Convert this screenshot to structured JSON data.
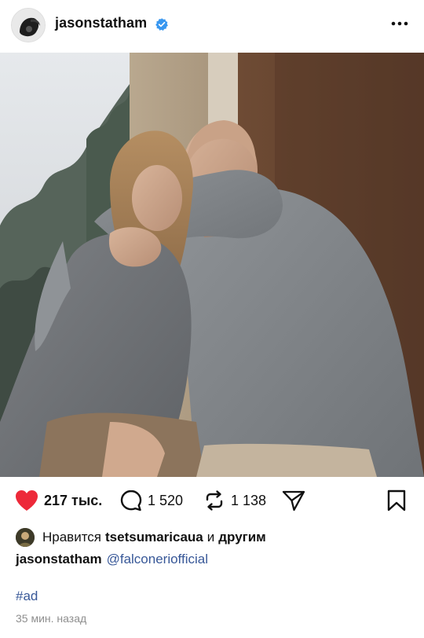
{
  "post": {
    "username": "jasonstatham",
    "likes_count": "217 тыс.",
    "comments_count": "1 520",
    "reposts_count": "1 138",
    "liked_by_prefix": "Нравится",
    "liked_by_user": "tsetsumaricauа",
    "liked_by_suffix": "и",
    "liked_by_others": "другим",
    "caption_user": "jasonstatham",
    "caption_mention": "@falconeriofficial",
    "hashtag": "#ad",
    "time_ago": "35 мин. назад"
  },
  "colors": {
    "like_red": "#ed2939",
    "link_blue": "#385898",
    "verified_blue": "#3897f0",
    "muted": "#8e8e8e"
  },
  "icons": [
    "avatar",
    "verified-badge-icon",
    "more-options-icon",
    "heart-icon",
    "comment-icon",
    "repost-icon",
    "share-icon",
    "bookmark-icon"
  ]
}
